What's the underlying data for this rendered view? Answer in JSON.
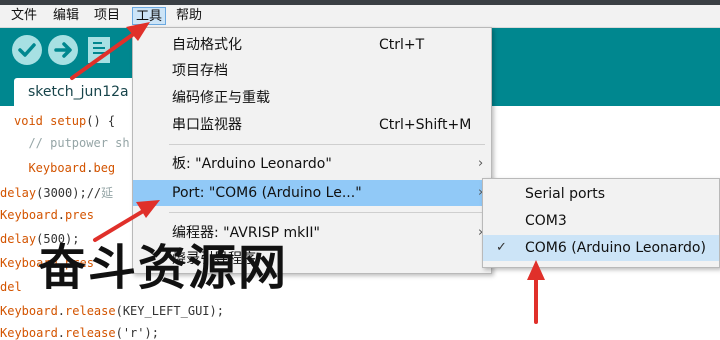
{
  "menubar": {
    "items": [
      "文件",
      "编辑",
      "项目",
      "工具",
      "帮助"
    ],
    "active": "工具"
  },
  "tab": {
    "label": "sketch_jun12a"
  },
  "code": {
    "lines": [
      [
        "void ",
        "setup",
        "() {"
      ],
      [
        "  // putpower sh"
      ],
      [
        "  ",
        "Keyboard",
        ".",
        "beg"
      ],
      [
        "delay",
        "(3000);//",
        "延"
      ],
      [
        "Keyboard",
        ".",
        "pres"
      ],
      [
        "delay",
        "(500);"
      ],
      [
        "Keyb",
        "oard",
        ".",
        "pres"
      ],
      [
        "del"
      ],
      [
        "Keyboard",
        ".",
        "release",
        "(KEY_LEFT_GUI);"
      ],
      [
        "Keyboard",
        ".",
        "release",
        "('r');"
      ]
    ]
  },
  "tools_menu": {
    "items": [
      {
        "label": "自动格式化",
        "shortcut": "Ctrl+T"
      },
      {
        "label": "项目存档",
        "shortcut": ""
      },
      {
        "label": "编码修正与重载",
        "shortcut": ""
      },
      {
        "label": "串口监视器",
        "shortcut": "Ctrl+Shift+M"
      },
      {
        "label": "板: \"Arduino Leonardo\"",
        "arrow": "›"
      },
      {
        "label": "Port: \"COM6 (Arduino Le...\"",
        "arrow": "›"
      },
      {
        "label": "编程器: \"AVRISP mkII\"",
        "arrow": "›"
      },
      {
        "label": "烧录引导程序"
      }
    ]
  },
  "port_submenu": {
    "items": [
      {
        "label": "Serial ports"
      },
      {
        "label": "COM3"
      },
      {
        "label": "COM6 (Arduino Leonardo)",
        "checked": "✓"
      }
    ]
  },
  "watermark": "奋斗资源网",
  "colors": {
    "toolbar": "#00878f",
    "highlight": "#91c9f7",
    "arrow": "#e0302a",
    "keyword": "#d35400"
  }
}
